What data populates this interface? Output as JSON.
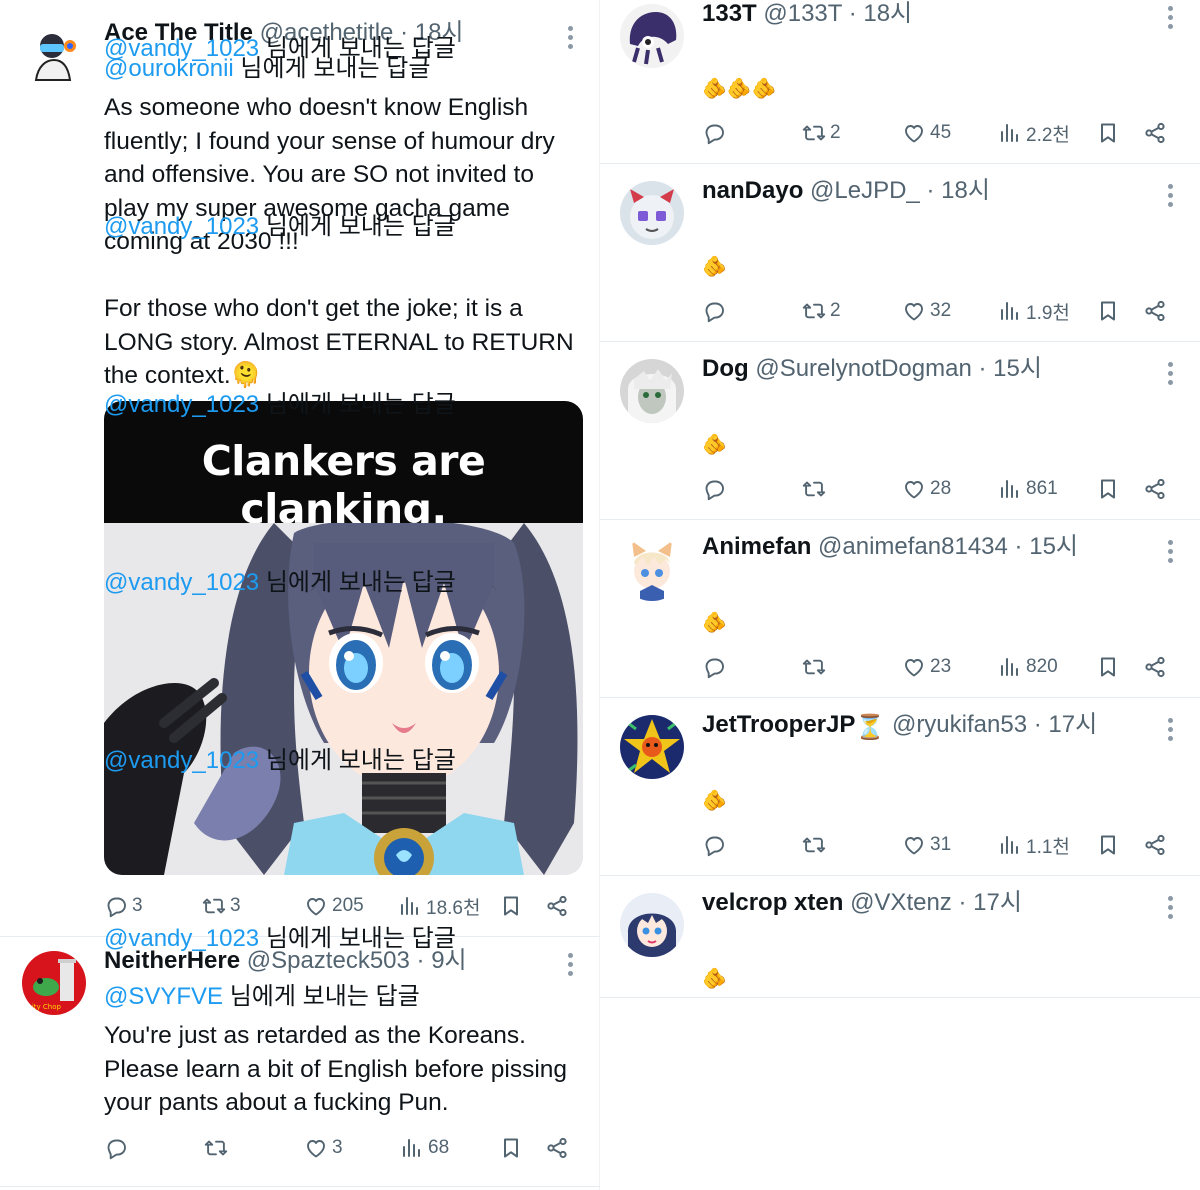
{
  "left_tweets": [
    {
      "name": "Ace The Title",
      "handle": "@acethetitle",
      "dot": "·",
      "time": "18시",
      "reply_mention": "@ourokronii",
      "reply_suffix": " 님에게 보내는 답글",
      "text": "As someone who doesn't know English fluently; I found your sense of humour dry and offensive. You are SO not invited to play my super awesome gacha game coming at 2030 !!!\n\nFor those who don't get the joke; it is a LONG story. Almost ETERNAL to RETURN the context.🫠",
      "media_caption": "Clankers are clanking.",
      "replies": "3",
      "retweets": "3",
      "likes": "205",
      "views": "18.6천"
    },
    {
      "name": "NeitherHere",
      "handle": "@Spazteck503",
      "dot": "·",
      "time": "9시",
      "reply_mention": "@SVYFVE",
      "reply_suffix": " 님에게 보내는 답글",
      "text": "You're just as retarded as the Koreans. Please learn a bit of English before pissing your pants about a fucking Pun.",
      "replies": "",
      "retweets": "",
      "likes": "3",
      "views": "68"
    }
  ],
  "right_tweets": [
    {
      "name": "133T",
      "handle": "@133T",
      "dot": "·",
      "time": "18시",
      "reply_mention": "@vandy_1023",
      "reply_suffix": " 님에게 보내는 답글",
      "emoji": "🫵🫵🫵",
      "replies": "",
      "retweets": "2",
      "likes": "45",
      "views": "2.2천"
    },
    {
      "name": "nanDayo",
      "handle": "@LeJPD_",
      "dot": "·",
      "time": "18시",
      "reply_mention": "@vandy_1023",
      "reply_suffix": " 님에게 보내는 답글",
      "emoji": "🫵",
      "replies": "",
      "retweets": "2",
      "likes": "32",
      "views": "1.9천"
    },
    {
      "name": "Dog",
      "handle": "@SurelynotDogman",
      "dot": "·",
      "time": "15시",
      "reply_mention": "@vandy_1023",
      "reply_suffix": " 님에게 보내는 답글",
      "emoji": "🫵",
      "replies": "",
      "retweets": "",
      "likes": "28",
      "views": "861"
    },
    {
      "name": "Animefan",
      "handle": "@animefan81434",
      "dot": "·",
      "time": "15시",
      "reply_mention": "@vandy_1023",
      "reply_suffix": " 님에게 보내는 답글",
      "emoji": "🫵",
      "replies": "",
      "retweets": "",
      "likes": "23",
      "views": "820"
    },
    {
      "name": "JetTrooperJP",
      "handle": "@ryukifan53",
      "dot": "·",
      "time": "17시",
      "reply_mention": "@vandy_1023",
      "reply_suffix": " 님에게 보내는 답글",
      "emoji": "🫵",
      "replies": "",
      "retweets": "",
      "likes": "31",
      "views": "1.1천",
      "badge": "⏳"
    },
    {
      "name": "velcrop xten",
      "handle": "@VXtenz",
      "dot": "·",
      "time": "17시",
      "reply_mention": "@vandy_1023",
      "reply_suffix": " 님에게 보내는 답글",
      "emoji": "🫵"
    }
  ],
  "colors": {
    "mention": "#1d9bf0",
    "muted": "#536471",
    "text": "#0f1419",
    "divider": "#e6ecf0"
  },
  "icons": [
    "reply-icon",
    "retweet-icon",
    "like-icon",
    "views-icon",
    "bookmark-icon",
    "share-icon",
    "more-icon"
  ]
}
